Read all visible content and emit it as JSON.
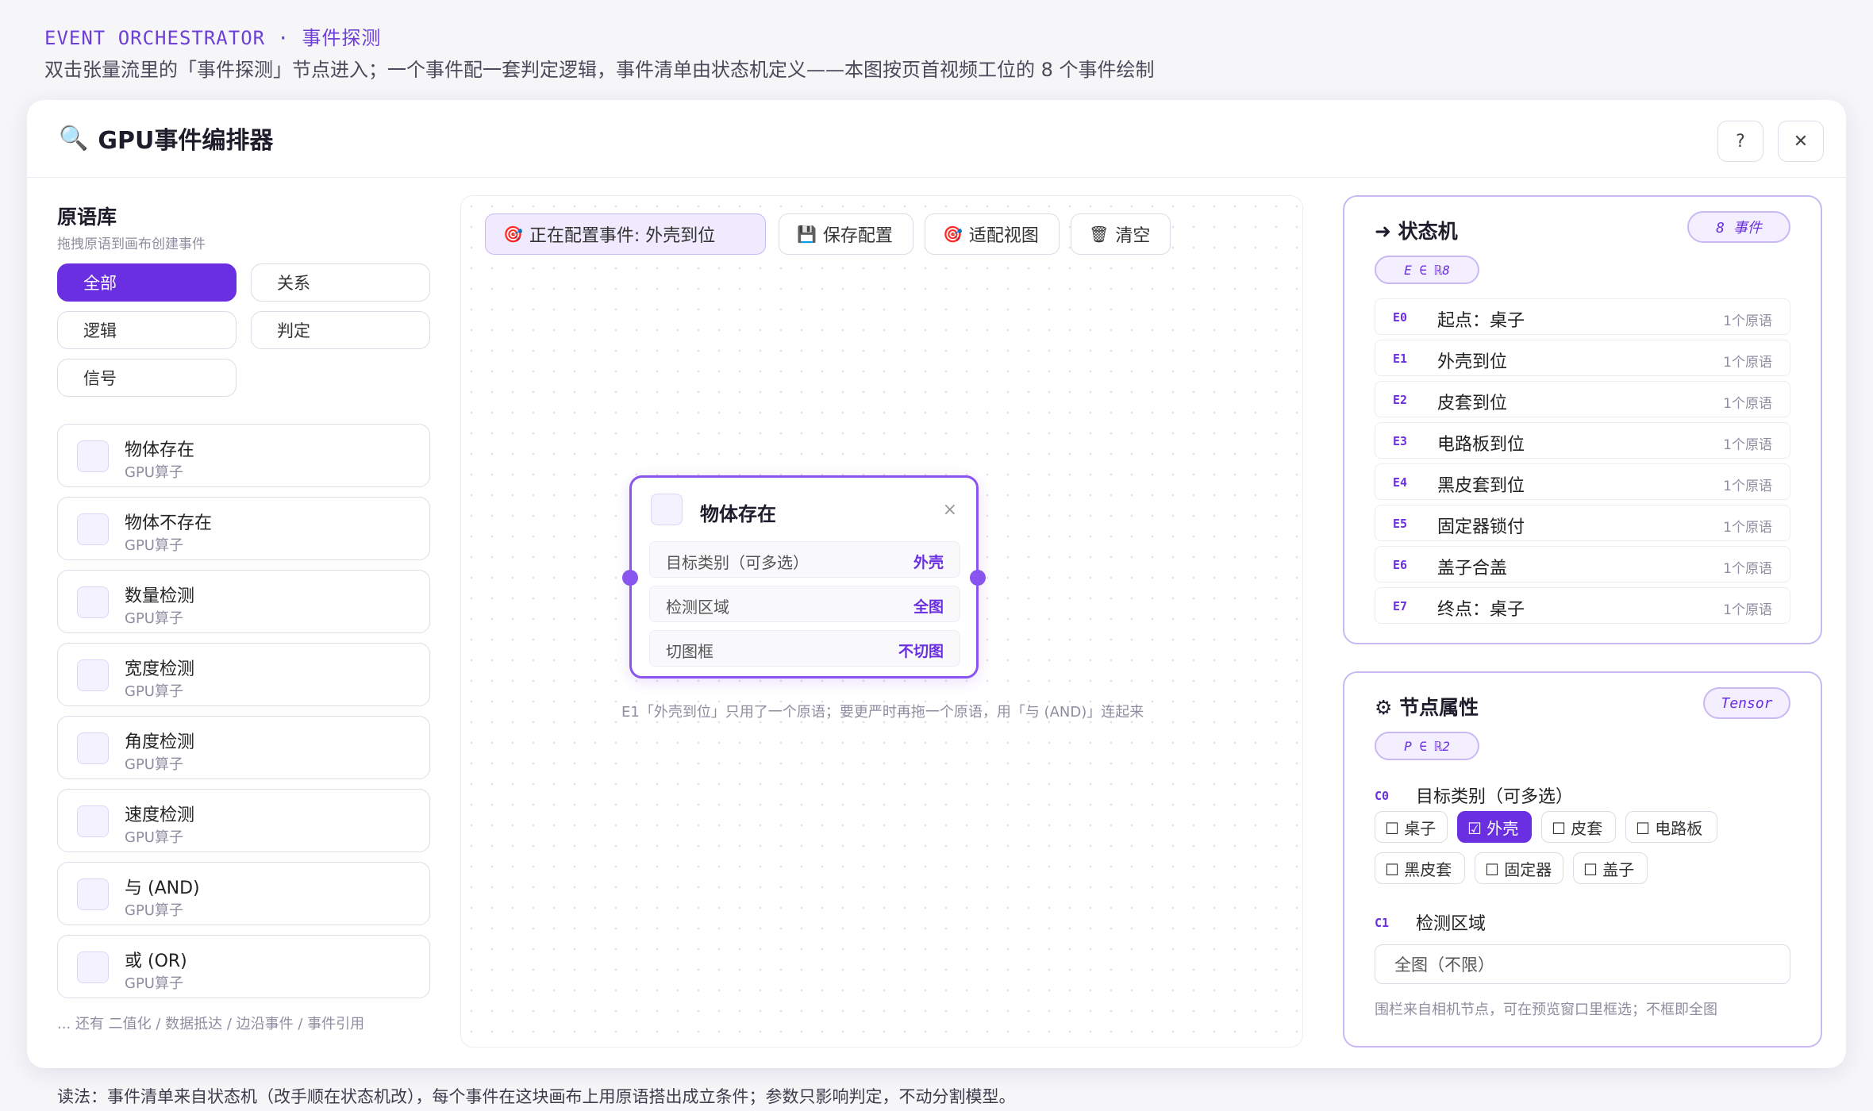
{
  "page": {
    "kicker_en": "EVENT ORCHESTRATOR · ",
    "kicker_cn": "事件探测",
    "subtitle": "双击张量流里的「事件探测」节点进入；一个事件配一套判定逻辑，事件清单由状态机定义——本图按页首视频工位的 8 个事件绘制",
    "footer": "读法：事件清单来自状态机（改手顺在状态机改），每个事件在这块画布上用原语搭出成立条件；参数只影响判定，不动分割模型。"
  },
  "window": {
    "icon": "🔍",
    "title": "GPU事件编排器",
    "help": "?",
    "close": "✕"
  },
  "library": {
    "title": "原语库",
    "subtitle": "拖拽原语到画布创建事件",
    "filters": [
      "全部",
      "关系",
      "逻辑",
      "判定",
      "信号"
    ],
    "primitives": [
      {
        "name": "物体存在",
        "tag": "GPU算子"
      },
      {
        "name": "物体不存在",
        "tag": "GPU算子"
      },
      {
        "name": "数量检测",
        "tag": "GPU算子"
      },
      {
        "name": "宽度检测",
        "tag": "GPU算子"
      },
      {
        "name": "角度检测",
        "tag": "GPU算子"
      },
      {
        "name": "速度检测",
        "tag": "GPU算子"
      },
      {
        "name": "与 (AND)",
        "tag": "GPU算子"
      },
      {
        "name": "或 (OR)",
        "tag": "GPU算子"
      }
    ],
    "more": "... 还有 二值化 / 数据抵达 / 边沿事件 / 事件引用"
  },
  "toolbar": {
    "configuring": "正在配置事件: 外壳到位",
    "save": "保存配置",
    "fit": "适配视图",
    "clear": "清空",
    "icons": {
      "configuring": "🎯",
      "save": "💾",
      "fit": "🎯",
      "clear": "🗑"
    }
  },
  "node": {
    "title": "物体存在",
    "close": "×",
    "rows": [
      {
        "key": "目标类别（可多选）",
        "value": "外壳"
      },
      {
        "key": "检测区域",
        "value": "全图"
      },
      {
        "key": "切图框",
        "value": "不切图"
      }
    ],
    "hint": "E1「外壳到位」只用了一个原语；要更严时再拖一个原语，用「与 (AND)」连起来"
  },
  "state_machine": {
    "title": "➜ 状态机",
    "count_pill": "8 事件",
    "set_pill": "E ∈ ℝ8",
    "events": [
      {
        "id": "E0",
        "name": "起点：桌子",
        "count": "1个原语"
      },
      {
        "id": "E1",
        "name": "外壳到位",
        "count": "1个原语"
      },
      {
        "id": "E2",
        "name": "皮套到位",
        "count": "1个原语"
      },
      {
        "id": "E3",
        "name": "电路板到位",
        "count": "1个原语"
      },
      {
        "id": "E4",
        "name": "黑皮套到位",
        "count": "1个原语"
      },
      {
        "id": "E5",
        "name": "固定器锁付",
        "count": "1个原语"
      },
      {
        "id": "E6",
        "name": "盖子合盖",
        "count": "1个原语"
      },
      {
        "id": "E7",
        "name": "终点：桌子",
        "count": "1个原语"
      }
    ]
  },
  "properties": {
    "title": "⚙ 节点属性",
    "type_pill": "Tensor",
    "set_pill": "P ∈ ℝ2",
    "param0": {
      "id": "C0",
      "name": "目标类别（可多选）"
    },
    "classes": [
      {
        "label": "☐ 桌子",
        "on": false
      },
      {
        "label": "☑ 外壳",
        "on": true
      },
      {
        "label": "☐ 皮套",
        "on": false
      },
      {
        "label": "☐ 电路板",
        "on": false
      },
      {
        "label": "☐ 黑皮套",
        "on": false
      },
      {
        "label": "☐ 固定器",
        "on": false
      },
      {
        "label": "☐ 盖子",
        "on": false
      }
    ],
    "param1": {
      "id": "C1",
      "name": "检测区域"
    },
    "region_value": "全图（不限）",
    "hint": "围栏来自相机节点，可在预览窗口里框选；不框即全图"
  },
  "colors": {
    "accent": "#6a2fe0",
    "accent_light": "#efeafe",
    "border_accent": "#c9b9f3"
  }
}
